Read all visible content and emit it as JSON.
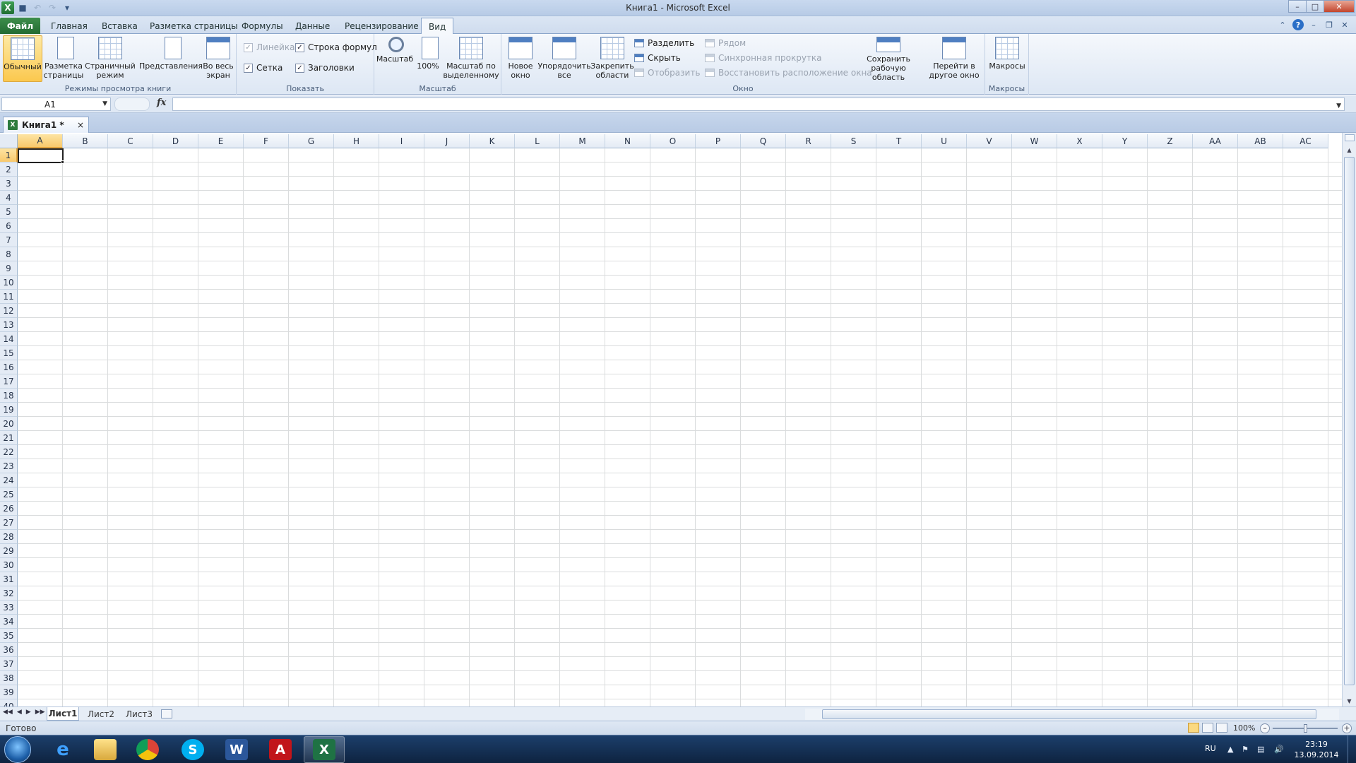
{
  "window": {
    "title": "Книга1 - Microsoft Excel"
  },
  "qat": {
    "icons": [
      "excel-logo-icon",
      "save-icon",
      "undo-icon",
      "redo-icon",
      "customize-icon"
    ]
  },
  "tabs": [
    "Файл",
    "Главная",
    "Вставка",
    "Разметка страницы",
    "Формулы",
    "Данные",
    "Рецензирование",
    "Вид"
  ],
  "active_tab": "Вид",
  "ribbon": {
    "views": {
      "label": "Режимы просмотра книги",
      "buttons": [
        "Обычный",
        "Разметка страницы",
        "Страничный режим",
        "Представления",
        "Во весь экран"
      ]
    },
    "show": {
      "label": "Показать",
      "checks": [
        {
          "text": "Линейка",
          "checked": true,
          "disabled": true
        },
        {
          "text": "Строка формул",
          "checked": true,
          "disabled": false
        },
        {
          "text": "Сетка",
          "checked": true,
          "disabled": false
        },
        {
          "text": "Заголовки",
          "checked": true,
          "disabled": false
        }
      ]
    },
    "zoom": {
      "label": "Масштаб",
      "buttons": [
        "Масштаб",
        "100%",
        "Масштаб по выделенному"
      ]
    },
    "window": {
      "label": "Окно",
      "big": [
        "Новое окно",
        "Упорядочить все",
        "Закрепить области"
      ],
      "small_a": [
        "Разделить",
        "Скрыть",
        "Отобразить"
      ],
      "small_b": [
        "Рядом",
        "Синхронная прокрутка",
        "Восстановить расположение окна"
      ],
      "big2": [
        "Сохранить рабочую область",
        "Перейти в другое окно"
      ]
    },
    "macros": {
      "label": "Макросы",
      "button": "Макросы"
    }
  },
  "formula_bar": {
    "name_box": "A1",
    "fx": "fx",
    "value": ""
  },
  "workbook_tab": {
    "title": "Книга1 *",
    "close": "×"
  },
  "columns": [
    "A",
    "B",
    "C",
    "D",
    "E",
    "F",
    "G",
    "H",
    "I",
    "J",
    "K",
    "L",
    "M",
    "N",
    "O",
    "P",
    "Q",
    "R",
    "S",
    "T",
    "U",
    "V",
    "W",
    "X",
    "Y",
    "Z",
    "AA",
    "AB",
    "AC"
  ],
  "rows_count": 40,
  "active_cell": "A1",
  "sheets": [
    "Лист1",
    "Лист2",
    "Лист3"
  ],
  "active_sheet": "Лист1",
  "status": {
    "ready": "Готово",
    "zoom": "100%"
  },
  "taskbar": {
    "apps": [
      "Internet Explorer",
      "File Explorer",
      "Google Chrome",
      "Skype",
      "Microsoft Word",
      "Adobe Reader",
      "Microsoft Excel"
    ],
    "lang": "RU",
    "time": "23:19",
    "date": "13.09.2014"
  }
}
